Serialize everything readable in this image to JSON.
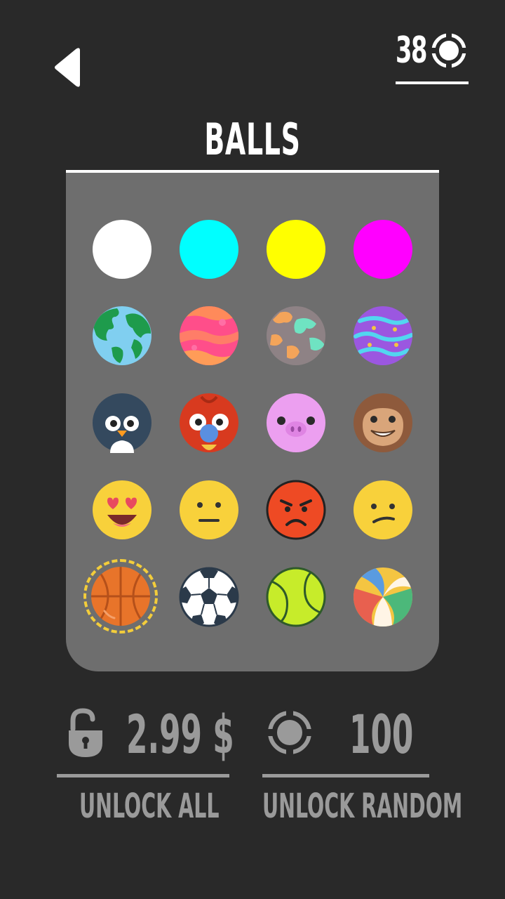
{
  "header": {
    "coins": "38",
    "coin_icon": "coin-target-icon",
    "back_icon": "back-arrow-icon"
  },
  "title": "BALLS",
  "balls": [
    {
      "name": "white",
      "color": "#ffffff"
    },
    {
      "name": "cyan",
      "color": "#00ffff"
    },
    {
      "name": "yellow",
      "color": "#ffff00"
    },
    {
      "name": "magenta",
      "color": "#ff00ff"
    },
    {
      "name": "earth",
      "icon": "earth-planet-icon"
    },
    {
      "name": "pink-planet",
      "icon": "pink-planet-icon"
    },
    {
      "name": "camo-planet",
      "icon": "camo-planet-icon"
    },
    {
      "name": "purple-planet",
      "icon": "purple-planet-icon"
    },
    {
      "name": "penguin",
      "icon": "penguin-face-icon"
    },
    {
      "name": "parrot",
      "icon": "parrot-face-icon"
    },
    {
      "name": "pig",
      "icon": "pig-face-icon"
    },
    {
      "name": "monkey",
      "icon": "monkey-face-icon"
    },
    {
      "name": "heart-eyes",
      "icon": "heart-eyes-emoji-icon"
    },
    {
      "name": "neutral",
      "icon": "neutral-emoji-icon"
    },
    {
      "name": "angry",
      "icon": "angry-emoji-icon"
    },
    {
      "name": "confused",
      "icon": "confused-emoji-icon"
    },
    {
      "name": "basketball",
      "icon": "basketball-icon",
      "selected": true
    },
    {
      "name": "soccer",
      "icon": "soccer-ball-icon"
    },
    {
      "name": "tennis",
      "icon": "tennis-ball-icon"
    },
    {
      "name": "volleyball",
      "icon": "volleyball-icon"
    }
  ],
  "unlock_all": {
    "price": "2.99 $",
    "label": "UNLOCK ALL",
    "icon": "unlock-padlock-icon"
  },
  "unlock_random": {
    "cost": "100",
    "label": "UNLOCK RANDOM",
    "icon": "coin-target-icon"
  }
}
